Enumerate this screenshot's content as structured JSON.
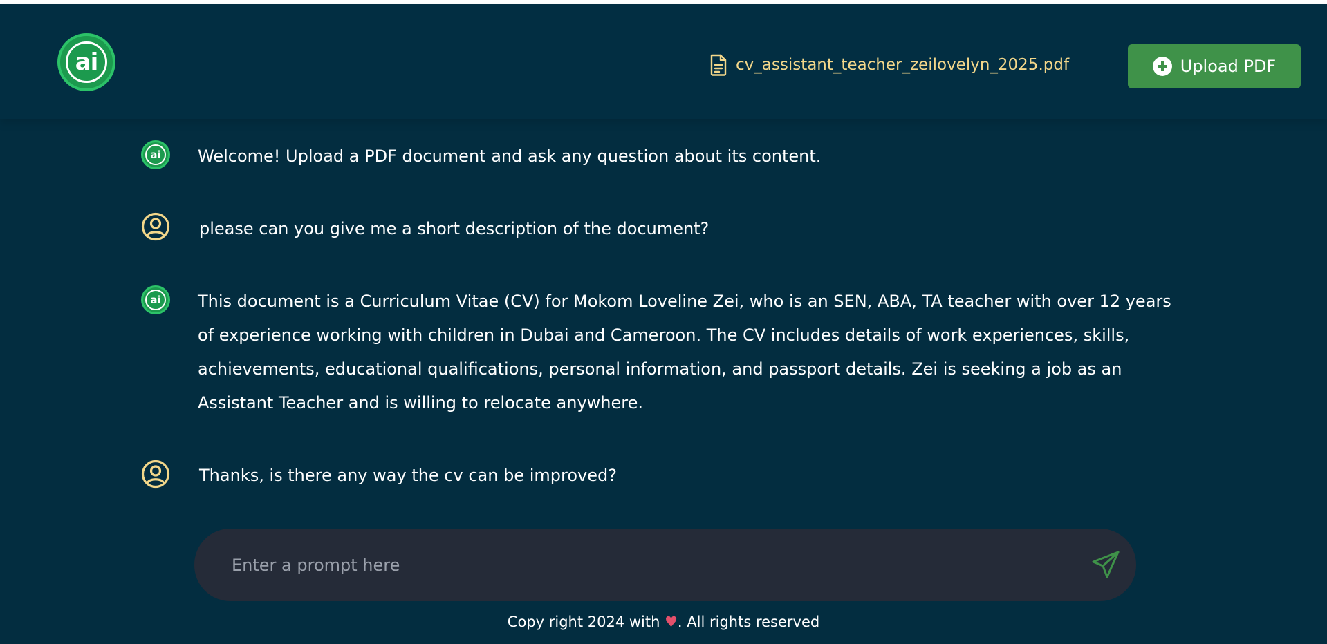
{
  "header": {
    "logo_text": "ai",
    "file_name": "cv_assistant_teacher_zeilovelyn_2025.pdf",
    "upload_label": "Upload PDF"
  },
  "messages": [
    {
      "role": "ai",
      "text": "Welcome! Upload a PDF document and ask any question about its content."
    },
    {
      "role": "user",
      "text": "please can you give me a short description of the document?"
    },
    {
      "role": "ai",
      "text": "This document is a Curriculum Vitae (CV) for Mokom Loveline Zei, who is an SEN, ABA, TA teacher with over 12 years of experience working with children in Dubai and Cameroon. The CV includes details of work experiences, skills, achievements, educational qualifications, personal information, and passport details. Zei is seeking a job as an Assistant Teacher and is willing to relocate anywhere."
    },
    {
      "role": "user",
      "text": "Thanks, is there any way the cv can be improved?"
    }
  ],
  "prompt": {
    "placeholder": "Enter a prompt here",
    "value": ""
  },
  "footer": {
    "text_before": "Copy right 2024 with ",
    "heart": "♥",
    "text_after": ". All rights reserved"
  },
  "colors": {
    "background": "#032d40",
    "accent_green": "#3f9249",
    "logo_green": "#1c9a4e",
    "file_name_color": "#f3d78a",
    "user_icon_color": "#f3d78a",
    "prompt_bg": "#252b38"
  }
}
